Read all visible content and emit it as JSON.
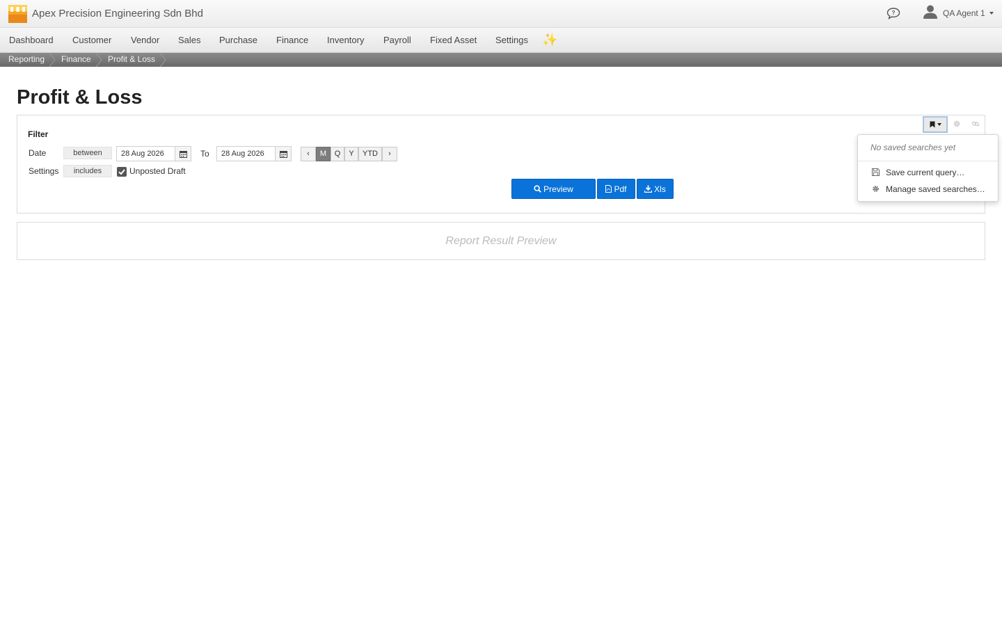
{
  "app": {
    "company_name": "Apex Precision Engineering Sdn Bhd",
    "user_name": "QA Agent 1"
  },
  "menu": {
    "items": [
      "Dashboard",
      "Customer",
      "Vendor",
      "Sales",
      "Purchase",
      "Finance",
      "Inventory",
      "Payroll",
      "Fixed Asset",
      "Settings"
    ],
    "sparkle_glyph": "✨"
  },
  "breadcrumb": [
    "Reporting",
    "Finance",
    "Profit & Loss"
  ],
  "page": {
    "title": "Profit & Loss"
  },
  "filter": {
    "heading": "Filter",
    "date": {
      "label": "Date",
      "operator": "between",
      "from": "28 Aug 2026",
      "to_label": "To",
      "to": "28 Aug 2026"
    },
    "periods": [
      {
        "label": "‹"
      },
      {
        "label": "M",
        "active": true
      },
      {
        "label": "Q"
      },
      {
        "label": "Y"
      },
      {
        "label": "YTD"
      },
      {
        "label": "›"
      }
    ],
    "settings": {
      "label": "Settings",
      "operator": "includes",
      "checkbox_label": "Unposted Draft",
      "checked": true
    },
    "actions": {
      "preview": "Preview",
      "pdf": "Pdf",
      "xls": "Xls"
    }
  },
  "saved_searches": {
    "empty_text": "No saved searches yet",
    "save": "Save current query…",
    "manage": "Manage saved searches…"
  },
  "result": {
    "placeholder": "Report Result Preview"
  },
  "colors": {
    "primary": "#0a73d9",
    "crumb_bar": "#7a7a7a",
    "logo_orange": "#f5a623"
  }
}
